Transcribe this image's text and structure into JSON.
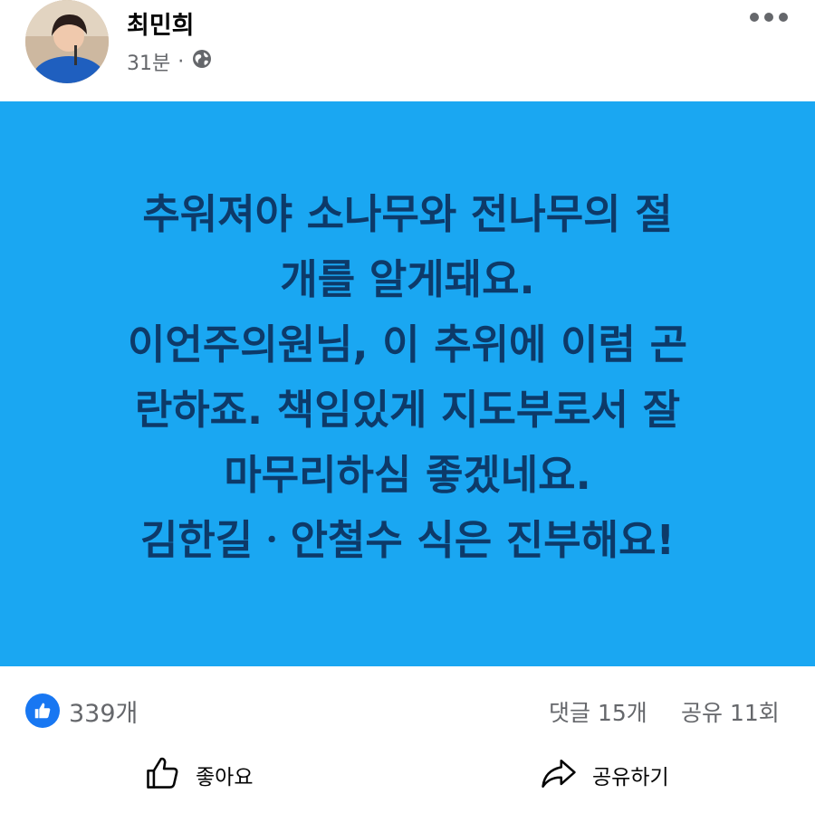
{
  "post": {
    "author": "최민희",
    "time": "31분",
    "separator": "·",
    "privacy_icon": "globe-icon",
    "lines": [
      "추워져야 소나무와 전나무의 절",
      "개를 알게돼요.",
      "이언주의원님, 이 추위에 이럼 곤",
      "란하죠. 책임있게 지도부로서 잘",
      "마무리하심 좋겠네요.",
      "김한길ㆍ안철수 식은 진부해요!"
    ],
    "background_color": "#1aa7f2",
    "text_color": "#0d3a69"
  },
  "stats": {
    "likes": "339개",
    "comments": "댓글 15개",
    "shares": "공유 11회"
  },
  "actions": {
    "like_label": "좋아요",
    "share_label": "공유하기"
  },
  "colors": {
    "accent": "#1877f2",
    "secondary_text": "#65676b"
  }
}
